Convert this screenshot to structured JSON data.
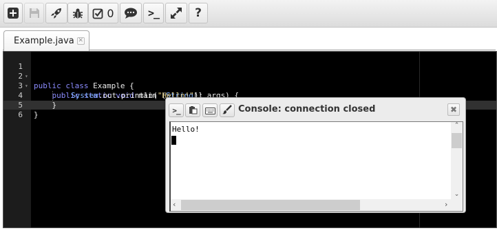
{
  "toolbar": {
    "buttons": [
      {
        "name": "add-icon"
      },
      {
        "name": "save-icon",
        "disabled": true
      },
      {
        "name": "rocket-icon"
      },
      {
        "name": "bug-icon"
      },
      {
        "name": "checkbox-icon",
        "count": "0"
      },
      {
        "name": "chat-icon"
      },
      {
        "name": "terminal-icon",
        "label": ">_"
      },
      {
        "name": "expand-icon"
      },
      {
        "name": "help-icon",
        "label": "?"
      }
    ]
  },
  "tabs": [
    {
      "label": "Example.java"
    }
  ],
  "editor": {
    "lines": [
      {
        "num": "1",
        "fold": true
      },
      {
        "num": "2",
        "fold": true
      },
      {
        "num": "3",
        "fold": false
      },
      {
        "num": "4",
        "fold": false
      },
      {
        "num": "5",
        "fold": false
      },
      {
        "num": "6",
        "fold": false
      }
    ],
    "code": {
      "l1_kw": "public class",
      "l1_rest": " Example {",
      "l2_kw": "public static void",
      "l2_main": " main (",
      "l2_type": "String",
      "l2_rest": "[] args) {",
      "l3_type": "System",
      "l3_call": ".out.println(",
      "l3_str": "\"Hello!\"",
      "l3_end": ");",
      "l4": "}",
      "l5": "}"
    }
  },
  "console": {
    "title": "Console: connection closed",
    "output": "Hello!",
    "close_label": "✖",
    "terminal_label": ">_"
  }
}
